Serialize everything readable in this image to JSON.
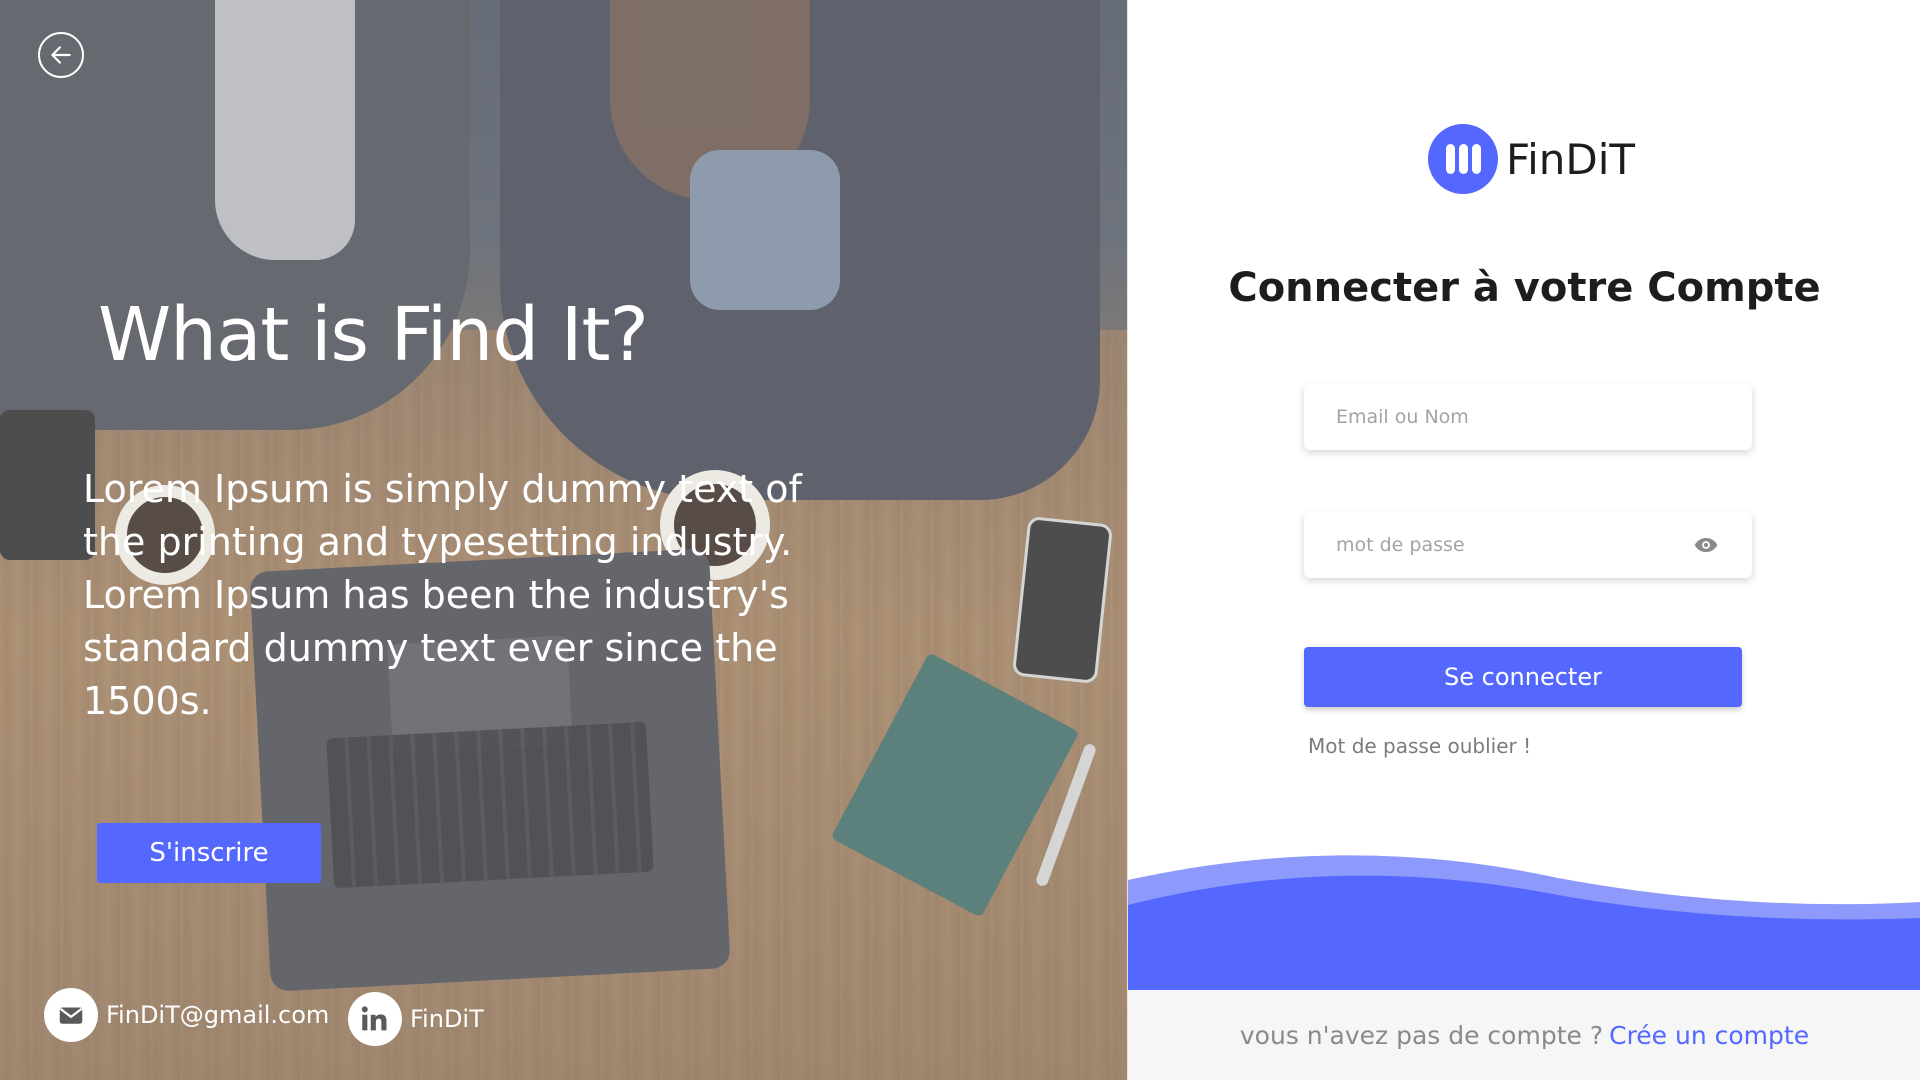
{
  "hero": {
    "title": "What is Find It?",
    "text": "Lorem Ipsum is simply dummy text of the printing and typesetting industry. Lorem Ipsum has been the industry's standard dummy text ever since the 1500s.",
    "signup_label": "S'inscrire",
    "email": "FinDiT@gmail.com",
    "linkedin": "FinDiT",
    "icons": {
      "back": "arrow-left-icon",
      "email": "mail-icon",
      "linkedin": "linkedin-icon"
    }
  },
  "login": {
    "brand": "FinDiT",
    "title": "Connecter à votre Compte",
    "email_placeholder": "Email ou Nom",
    "password_placeholder": "mot de passe",
    "submit_label": "Se connecter",
    "forgot_label": "Mot de passe oublier !",
    "no_account": "vous n'avez pas de compte ?",
    "create_account": "Crée un compte"
  },
  "colors": {
    "accent": "#5468ff",
    "wave_light": "#8d99fb"
  }
}
